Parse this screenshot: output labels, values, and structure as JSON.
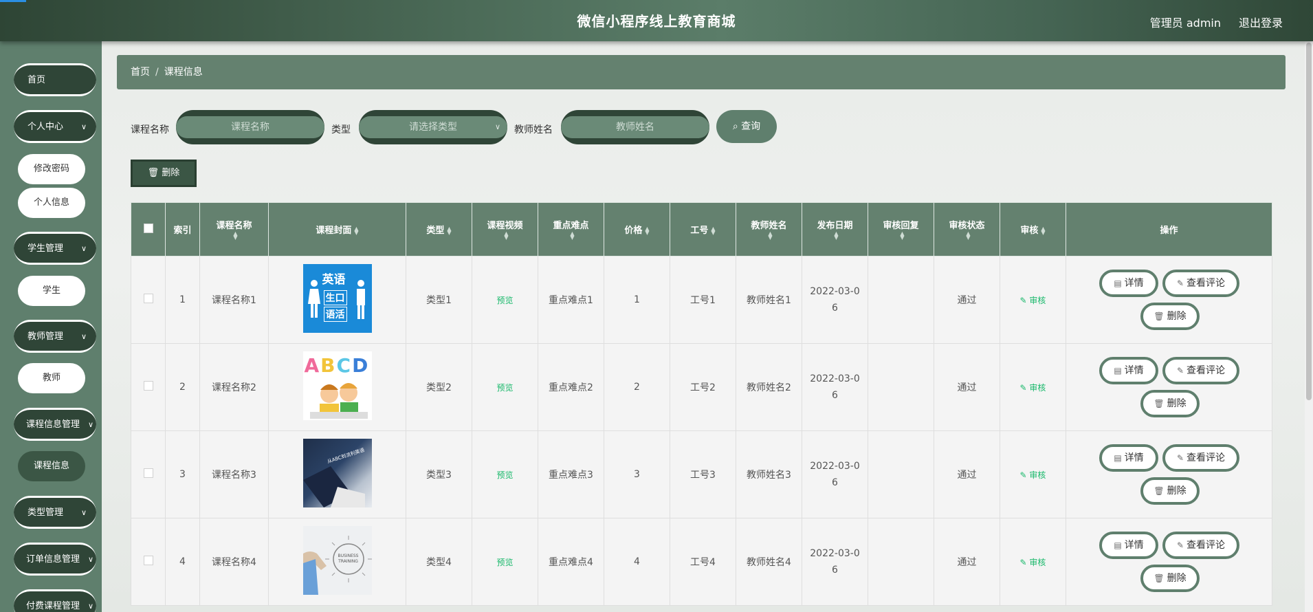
{
  "header": {
    "title": "微信小程序线上教育商城",
    "user": "管理员 admin",
    "logout": "退出登录"
  },
  "sidebar": {
    "items": [
      {
        "label": "首页"
      },
      {
        "label": "个人中心",
        "sub": [
          "修改密码",
          "个人信息"
        ]
      },
      {
        "label": "学生管理",
        "sub": [
          "学生"
        ]
      },
      {
        "label": "教师管理",
        "sub": [
          "教师"
        ]
      },
      {
        "label": "课程信息管理",
        "sub": [
          "课程信息"
        ]
      },
      {
        "label": "类型管理"
      },
      {
        "label": "订单信息管理"
      },
      {
        "label": "付费课程管理"
      }
    ]
  },
  "breadcrumb": {
    "home": "首页",
    "current": "课程信息"
  },
  "filters": {
    "course_name_label": "课程名称",
    "course_name_placeholder": "课程名称",
    "type_label": "类型",
    "type_placeholder": "请选择类型",
    "teacher_label": "教师姓名",
    "teacher_placeholder": "教师姓名",
    "query_label": "查询"
  },
  "toolbar": {
    "delete_label": "删除"
  },
  "table": {
    "headers": [
      "索引",
      "课程名称",
      "课程封面",
      "类型",
      "课程视频",
      "重点难点",
      "价格",
      "工号",
      "教师姓名",
      "发布日期",
      "审核回复",
      "审核状态",
      "审核",
      "操作"
    ],
    "rows": [
      {
        "index": "1",
        "name": "课程名称1",
        "type": "类型1",
        "video": "预览",
        "key": "重点难点1",
        "price": "1",
        "job_no": "工号1",
        "teacher": "教师姓名1",
        "date": "2022-03-06",
        "reply": "",
        "status": "通过",
        "audit": "审核"
      },
      {
        "index": "2",
        "name": "课程名称2",
        "type": "类型2",
        "video": "预览",
        "key": "重点难点2",
        "price": "2",
        "job_no": "工号2",
        "teacher": "教师姓名2",
        "date": "2022-03-06",
        "reply": "",
        "status": "通过",
        "audit": "审核"
      },
      {
        "index": "3",
        "name": "课程名称3",
        "type": "类型3",
        "video": "预览",
        "key": "重点难点3",
        "price": "3",
        "job_no": "工号3",
        "teacher": "教师姓名3",
        "date": "2022-03-06",
        "reply": "",
        "status": "通过",
        "audit": "审核"
      },
      {
        "index": "4",
        "name": "课程名称4",
        "type": "类型4",
        "video": "预览",
        "key": "重点难点4",
        "price": "4",
        "job_no": "工号4",
        "teacher": "教师姓名4",
        "date": "2022-03-06",
        "reply": "",
        "status": "通过",
        "audit": "审核"
      }
    ],
    "ops": {
      "detail": "详情",
      "comments": "查看评论",
      "delete": "删除"
    },
    "covers": [
      {
        "line1": "英语",
        "line2": "生口",
        "line3": "语活"
      },
      {
        "letters": "ABCD"
      },
      {
        "caption": "从ABC到流利英语"
      },
      {
        "caption": "BUSINESS TRAINING"
      }
    ]
  }
}
